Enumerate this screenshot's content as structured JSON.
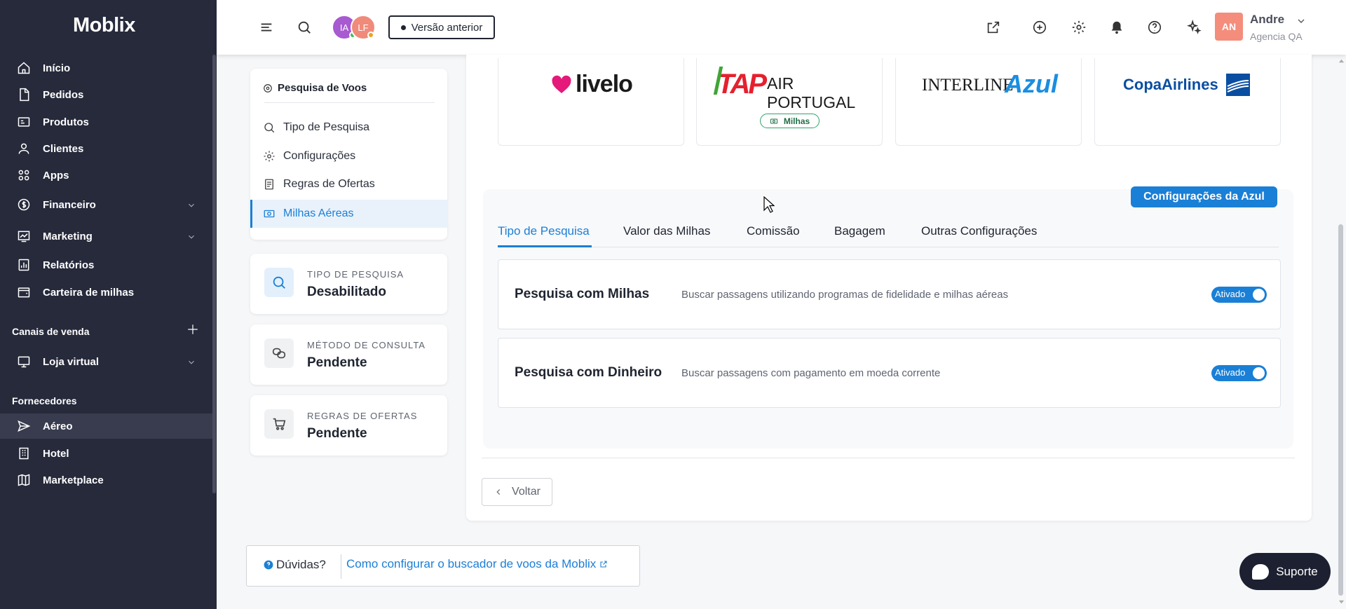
{
  "sidebar": {
    "logo": "Moblix",
    "items": [
      {
        "label": "Início",
        "icon": "home-icon"
      },
      {
        "label": "Pedidos",
        "icon": "file-icon"
      },
      {
        "label": "Produtos",
        "icon": "box-icon"
      },
      {
        "label": "Clientes",
        "icon": "user-icon"
      },
      {
        "label": "Apps",
        "icon": "apps-grid-icon"
      },
      {
        "label": "Financeiro",
        "icon": "dollar-icon"
      },
      {
        "label": "Marketing",
        "icon": "chart-icon"
      },
      {
        "label": "Relatórios",
        "icon": "report-icon"
      },
      {
        "label": "Carteira de milhas",
        "icon": "wallet-icon"
      }
    ],
    "sales_channels_title": "Canais de venda",
    "sales_channels": [
      {
        "label": "Loja virtual",
        "icon": "monitor-icon"
      }
    ],
    "suppliers_title": "Fornecedores",
    "suppliers": [
      {
        "label": "Aéreo",
        "icon": "plane-icon"
      },
      {
        "label": "Hotel",
        "icon": "building-icon"
      },
      {
        "label": "Marketplace",
        "icon": "map-icon"
      }
    ]
  },
  "topbar": {
    "avatars": [
      "IA",
      "LF"
    ],
    "version_button": "Versão anterior",
    "user": {
      "initials": "AN",
      "name": "Andre",
      "agency": "Agencia QA"
    }
  },
  "left_menu": {
    "title": "Pesquisa de Voos",
    "items": [
      {
        "label": "Tipo de Pesquisa"
      },
      {
        "label": "Configurações"
      },
      {
        "label": "Regras de Ofertas"
      },
      {
        "label": "Milhas Aéreas"
      }
    ]
  },
  "status_cards": [
    {
      "label": "TIPO DE PESQUISA",
      "value": "Desabilitado"
    },
    {
      "label": "MÉTODO DE CONSULTA",
      "value": "Pendente"
    },
    {
      "label": "REGRAS DE OFERTAS",
      "value": "Pendente"
    }
  ],
  "airlines": {
    "livelo": "livelo",
    "tap_prefix": "TAP",
    "tap_text": "AIR PORTUGAL",
    "azul_prefix": "INTERLINE",
    "azul_brand": "Azul",
    "copa": "CopaAirlines",
    "miles_badge": "Milhas"
  },
  "azul_config_button": "Configurações da Azul",
  "tabs": [
    {
      "label": "Tipo de Pesquisa"
    },
    {
      "label": "Valor das Milhas"
    },
    {
      "label": "Comissão"
    },
    {
      "label": "Bagagem"
    },
    {
      "label": "Outras Configurações"
    }
  ],
  "search_options": [
    {
      "title": "Pesquisa com Milhas",
      "description": "Buscar passagens utilizando programas de fidelidade e milhas aéreas",
      "toggle": "Ativado"
    },
    {
      "title": "Pesquisa com Dinheiro",
      "description": "Buscar passagens com pagamento em moeda corrente",
      "toggle": "Ativado"
    }
  ],
  "back_button": "Voltar",
  "help": {
    "question": "Dúvidas?",
    "link": "Como configurar o buscador de voos da Moblix"
  },
  "support_button": "Suporte",
  "colors": {
    "primary": "#1a7fd6",
    "sidebar": "#262a3b",
    "avatar_ia": "#a85ad0",
    "avatar_lf": "#f08a7a",
    "user_avatar": "#f48d7c",
    "tap_red": "#e5202e",
    "tap_green": "#3fa535",
    "copa_blue": "#0a4ea2"
  }
}
